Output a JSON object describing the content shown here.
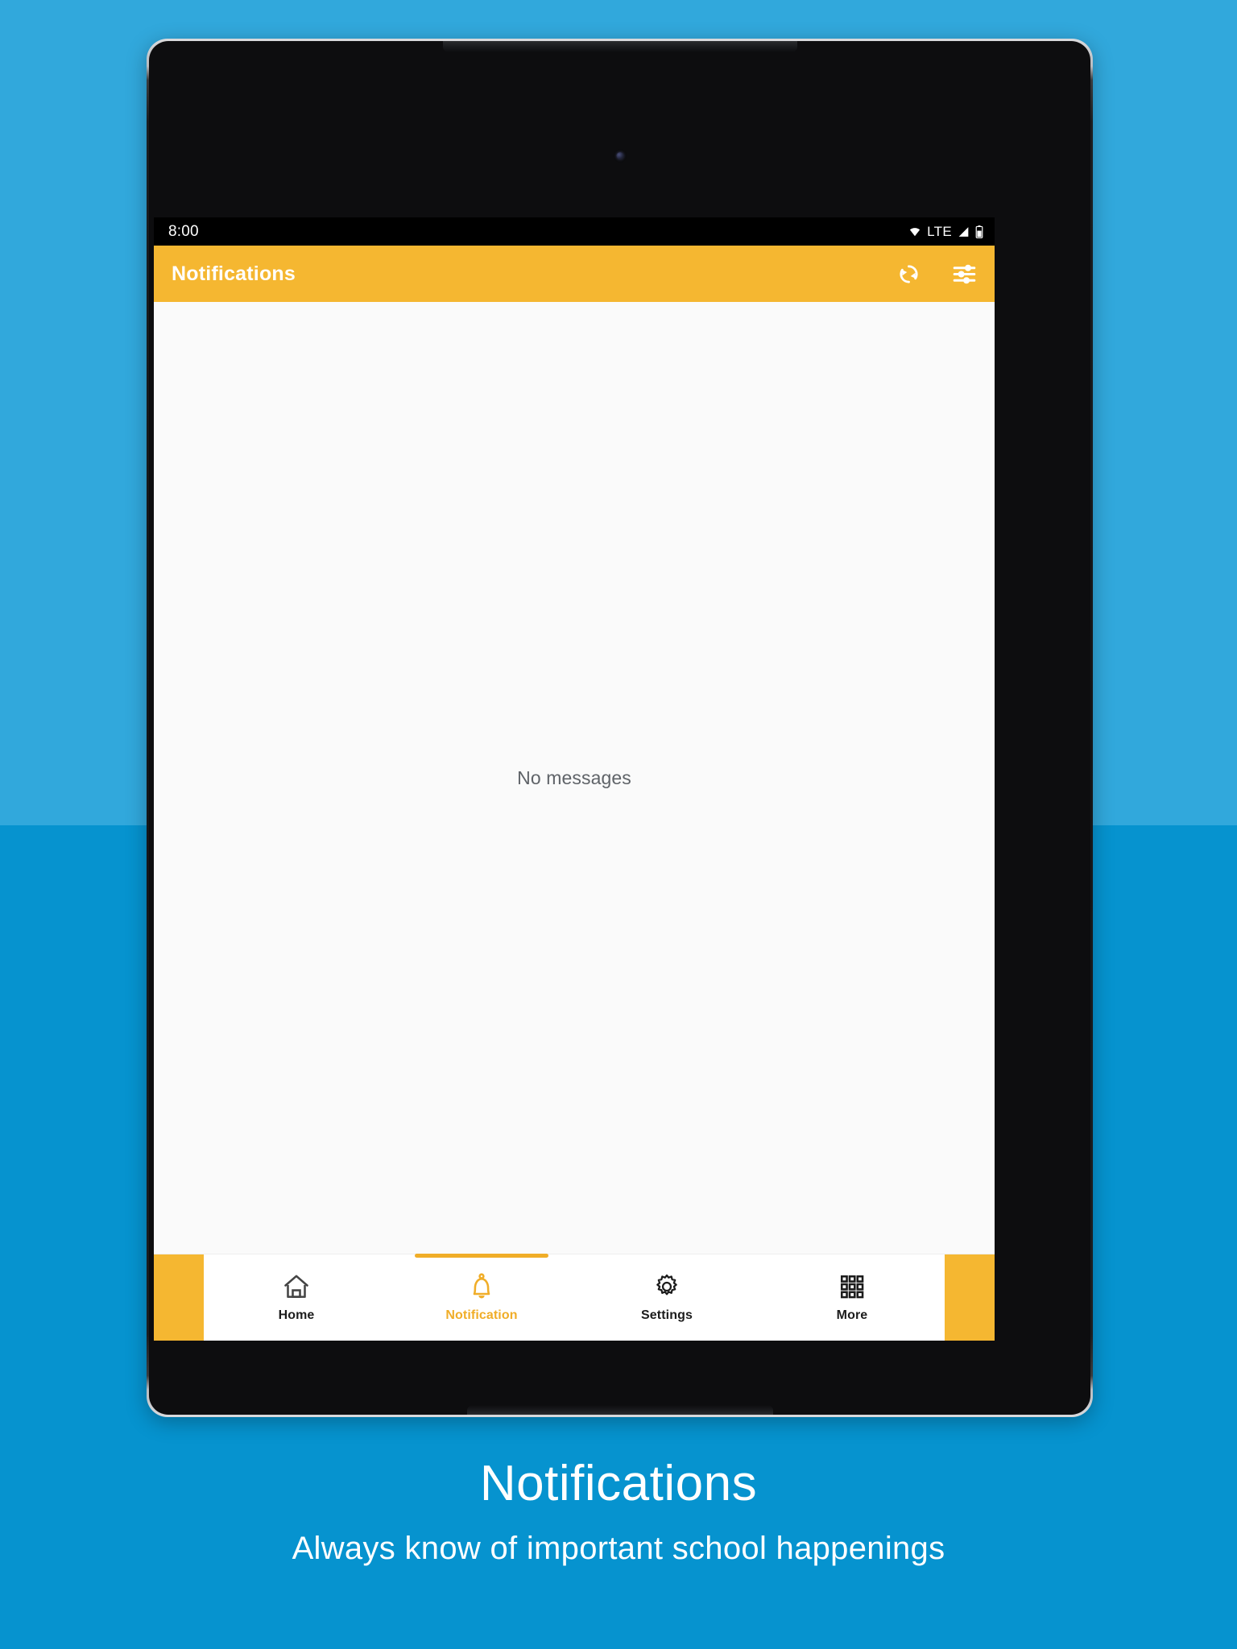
{
  "background": {
    "top_color": "#31a8dc",
    "bottom_color": "#0693cf"
  },
  "device": {
    "type": "android-tablet",
    "camera": "front-camera-dot"
  },
  "screen": {
    "statusbar": {
      "time": "8:00",
      "network_label": "LTE",
      "icons": [
        "wifi-icon",
        "signal-icon",
        "battery-icon"
      ]
    },
    "appbar": {
      "title": "Notifications",
      "accent_color": "#f5b731",
      "actions": [
        {
          "name": "refresh-icon",
          "label": "Refresh"
        },
        {
          "name": "filter-icon",
          "label": "Filter"
        }
      ]
    },
    "content": {
      "empty_state_text": "No messages"
    },
    "bottom_nav": {
      "active_color": "#f0ad28",
      "inactive_color": "#1c1c1c",
      "items": [
        {
          "label": "Home",
          "icon": "home-icon",
          "active": false
        },
        {
          "label": "Notification",
          "icon": "bell-icon",
          "active": true
        },
        {
          "label": "Settings",
          "icon": "gear-icon",
          "active": false
        },
        {
          "label": "More",
          "icon": "grid-icon",
          "active": false
        }
      ]
    },
    "system_nav": {
      "buttons": [
        "back-button",
        "home-button",
        "recents-button"
      ]
    }
  },
  "caption": {
    "title": "Notifications",
    "subtitle": "Always know of important school happenings"
  }
}
